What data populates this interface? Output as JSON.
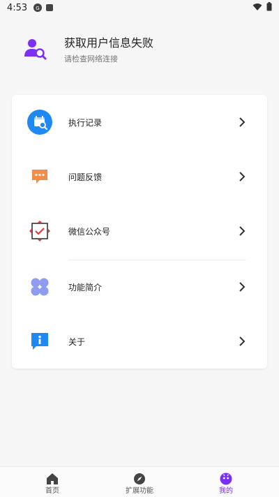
{
  "status_bar": {
    "time": "4:53"
  },
  "profile": {
    "title": "获取用户信息失败",
    "subtitle": "请检查网络连接"
  },
  "menu": {
    "items": [
      {
        "label": "执行记录",
        "icon": "calendar-search-icon"
      },
      {
        "label": "问题反馈",
        "icon": "chat-bubble-icon"
      },
      {
        "label": "微信公众号",
        "icon": "wechat-account-icon"
      },
      {
        "label": "功能简介",
        "icon": "grid-clover-icon"
      },
      {
        "label": "关于",
        "icon": "info-icon"
      }
    ]
  },
  "tabbar": {
    "tabs": [
      {
        "label": "首页",
        "icon": "home-icon"
      },
      {
        "label": "扩展功能",
        "icon": "compass-icon"
      },
      {
        "label": "我的",
        "icon": "profile-face-icon"
      }
    ],
    "active_color": "#7b2ff7"
  },
  "colors": {
    "accent": "#7b2ff7",
    "blue": "#1e88f5",
    "orange": "#f28c4b",
    "red": "#e33b3b",
    "lilac": "#8e9cf2"
  }
}
